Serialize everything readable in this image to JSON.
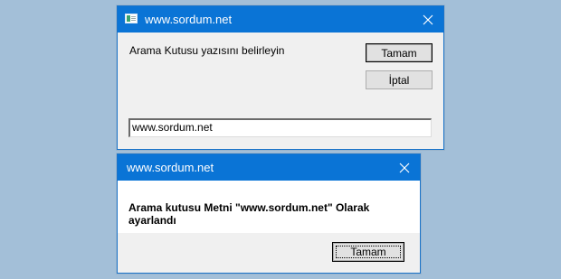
{
  "input_dialog": {
    "title": "www.sordum.net",
    "prompt": "Arama Kutusu yazısını belirleyin",
    "ok_label": "Tamam",
    "cancel_label": "İptal",
    "input_value": "www.sordum.net",
    "icon": "app-icon"
  },
  "message_dialog": {
    "title": "www.sordum.net",
    "message": "Arama kutusu Metni \"www.sordum.net\" Olarak ayarlandı",
    "ok_label": "Tamam"
  },
  "colors": {
    "desktop": "#a3bfd8",
    "titlebar": "#0a74d6",
    "dialog_bg": "#f0f0f0"
  }
}
